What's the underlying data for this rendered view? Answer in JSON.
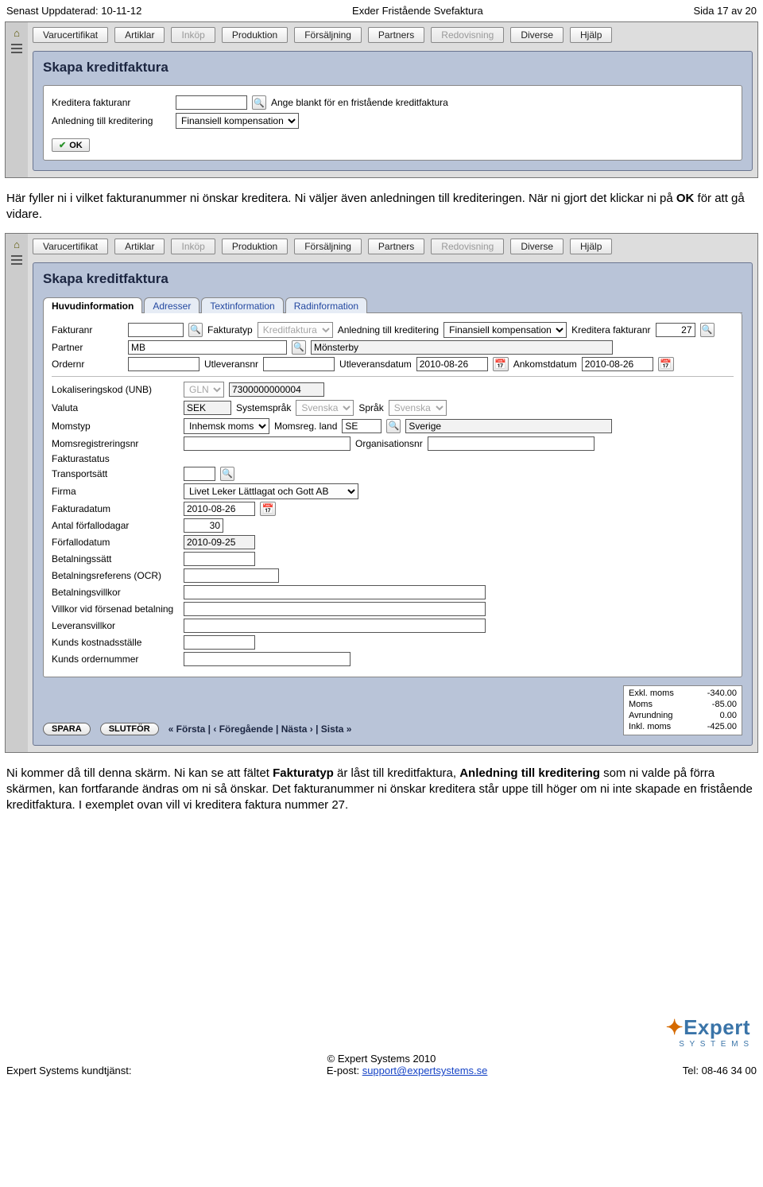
{
  "doc_header": {
    "left": "Senast Uppdaterad: 10-11-12",
    "center": "Exder Fristående Svefaktura",
    "right": "Sida 17 av 20"
  },
  "menu": {
    "items": [
      "Varucertifikat",
      "Artiklar",
      "Inköp",
      "Produktion",
      "Försäljning",
      "Partners",
      "Redovisning",
      "Diverse",
      "Hjälp"
    ],
    "disabled": [
      2,
      6
    ]
  },
  "screen1": {
    "title": "Skapa kreditfaktura",
    "fields": {
      "kreditera_fakturanr_label": "Kreditera fakturanr",
      "kreditera_fakturanr_value": "",
      "hint": "Ange blankt för en fristående kreditfaktura",
      "anledning_label": "Anledning till kreditering",
      "anledning_value": "Finansiell kompensation"
    },
    "ok_button": "OK"
  },
  "para1": "Här fyller ni i vilket fakturanummer ni önskar kreditera. Ni väljer även anledningen till krediteringen. När ni gjort det klickar ni på OK för att gå vidare.",
  "screen2": {
    "title": "Skapa kreditfaktura",
    "tabs": [
      "Huvudinformation",
      "Adresser",
      "Textinformation",
      "Radinformation"
    ],
    "active_tab": 0,
    "fields": {
      "fakturanr_label": "Fakturanr",
      "fakturanr_value": "",
      "fakturatyp_label": "Fakturatyp",
      "fakturatyp_value": "Kreditfaktura",
      "anledning_label": "Anledning till kreditering",
      "anledning_value": "Finansiell kompensation",
      "kreditera_fakturanr_label": "Kreditera fakturanr",
      "kreditera_fakturanr_value": "27",
      "partner_label": "Partner",
      "partner_code": "MB",
      "partner_name": "Mönsterby",
      "ordernr_label": "Ordernr",
      "ordernr_value": "",
      "utleveransnr_label": "Utleveransnr",
      "utleveransnr_value": "",
      "utleveransdatum_label": "Utleveransdatum",
      "utleveransdatum_value": "2010-08-26",
      "ankomstdatum_label": "Ankomstdatum",
      "ankomstdatum_value": "2010-08-26",
      "lokaliseringskod_label": "Lokaliseringskod (UNB)",
      "lokaliseringskod_sel": "GLN",
      "lokaliseringskod_value": "7300000000004",
      "valuta_label": "Valuta",
      "valuta_value": "SEK",
      "systemsprak_label": "Systemspråk",
      "systemsprak_value": "Svenska",
      "sprak_label": "Språk",
      "sprak_value": "Svenska",
      "momstyp_label": "Momstyp",
      "momstyp_value": "Inhemsk moms",
      "momsreg_label": "Momsreg. land",
      "momsreg_code": "SE",
      "momsreg_name": "Sverige",
      "momsregnr_label": "Momsregistreringsnr",
      "momsregnr_value": "",
      "orgnr_label": "Organisationsnr",
      "orgnr_value": "",
      "fakturastatus_label": "Fakturastatus",
      "transportsatt_label": "Transportsätt",
      "transportsatt_value": "",
      "firma_label": "Firma",
      "firma_value": "Livet Leker Lättlagat och Gott AB",
      "fakturadatum_label": "Fakturadatum",
      "fakturadatum_value": "2010-08-26",
      "antal_forfallodagar_label": "Antal förfallodagar",
      "antal_forfallodagar_value": "30",
      "forfallodatum_label": "Förfallodatum",
      "forfallodatum_value": "2010-09-25",
      "betalningssatt_label": "Betalningssätt",
      "betalningssatt_value": "",
      "ocr_label": "Betalningsreferens (OCR)",
      "ocr_value": "",
      "betalningsvillkor_label": "Betalningsvillkor",
      "betalningsvillkor_value": "",
      "villkor_forsenad_label": "Villkor vid försenad betalning",
      "villkor_forsenad_value": "",
      "leveransvillkor_label": "Leveransvillkor",
      "leveransvillkor_value": "",
      "kunds_kostnadsstalle_label": "Kunds kostnadsställe",
      "kunds_kostnadsstalle_value": "",
      "kunds_ordernr_label": "Kunds ordernummer",
      "kunds_ordernr_value": ""
    },
    "pager": {
      "spara": "SPARA",
      "slutfor": "SLUTFÖR",
      "nav": "« Första  |  ‹ Föregående  |  Nästa ›  |  Sista »"
    },
    "totals": {
      "exkl_label": "Exkl. moms",
      "exkl_val": "-340.00",
      "moms_label": "Moms",
      "moms_val": "-85.00",
      "avr_label": "Avrundning",
      "avr_val": "0.00",
      "inkl_label": "Inkl. moms",
      "inkl_val": "-425.00"
    }
  },
  "para2_parts": {
    "a": "Ni kommer då till denna skärm. Ni kan se att fältet ",
    "b": "Fakturatyp",
    "c": " är låst till kreditfaktura, ",
    "d": "Anledning till kreditering",
    "e": " som ni valde på förra skärmen, kan fortfarande ändras om ni så önskar. Det fakturanummer ni önskar kreditera står uppe till höger om ni inte skapade en fristående kreditfaktura. I exemplet ovan vill vi kreditera faktura nummer 27."
  },
  "footer": {
    "copyright": "© Expert Systems 2010",
    "left": "Expert Systems kundtjänst:",
    "mid_prefix": "E-post: ",
    "mid_link": "support@expertsystems.se",
    "right": "Tel: 08-46 34 00",
    "brand": "Expert",
    "brand_sub": "S  Y  S  T  E  M  S"
  }
}
